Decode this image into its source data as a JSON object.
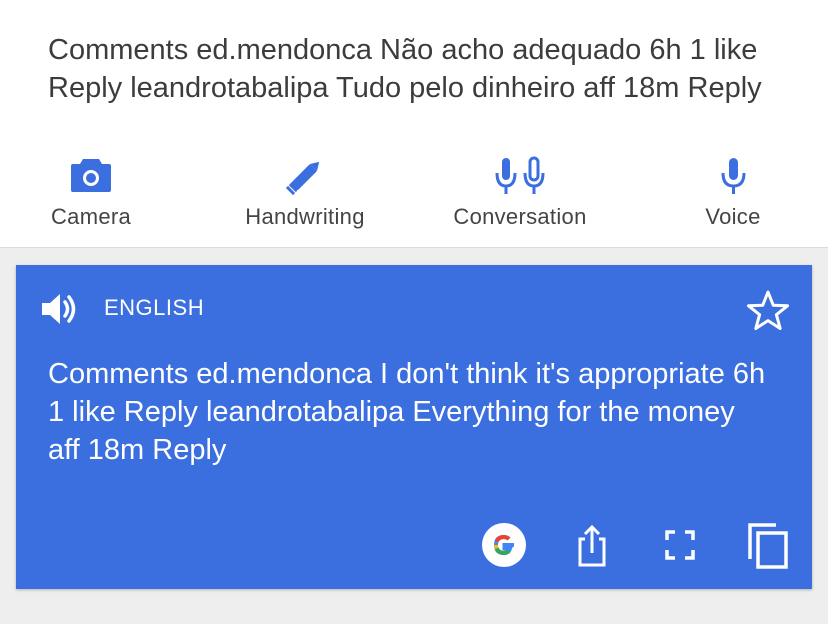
{
  "source": {
    "text": "Comments ed.mendonca Não acho adequado 6h 1 like Reply leandrotabalipa Tudo pelo dinheiro aff 18m Reply"
  },
  "input_modes": {
    "camera": {
      "label": "Camera",
      "icon": "camera-icon"
    },
    "handwriting": {
      "label": "Handwriting",
      "icon": "pen-icon"
    },
    "conversation": {
      "label": "Conversation",
      "icon": "conversation-mics-icon"
    },
    "voice": {
      "label": "Voice",
      "icon": "mic-icon"
    }
  },
  "translation": {
    "language": "ENGLISH",
    "text": "Comments ed.mendonca I don't think it's appropriate 6h 1 like Reply leandrotabalipa Everything for the money aff 18m Reply"
  },
  "icons": {
    "speaker": "speaker-icon",
    "star": "star-outline-icon",
    "google": "google-g-icon",
    "share": "share-icon",
    "fullscreen": "fullscreen-icon",
    "copy": "copy-icon"
  },
  "colors": {
    "accent": "#3b6fe0",
    "mode_icon": "#3b6fe0",
    "background": "#eeeeee"
  }
}
